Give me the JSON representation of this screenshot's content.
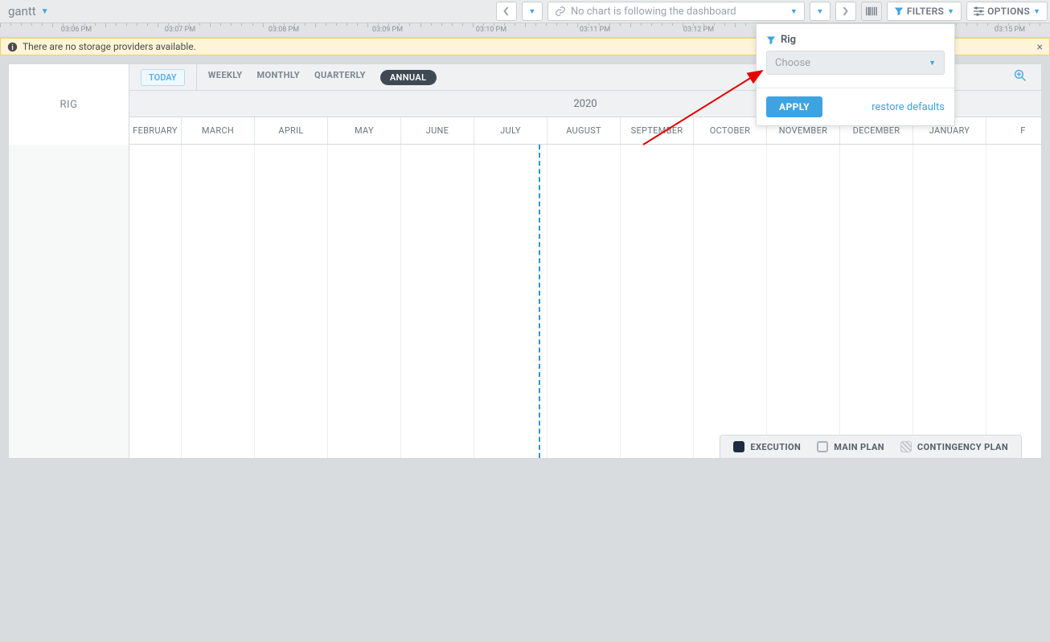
{
  "header": {
    "title": "gantt",
    "follow_text": "No chart is following the dashboard",
    "filters_label": "FILTERS",
    "options_label": "OPTIONS"
  },
  "ruler": {
    "labels": [
      "03:06 PM",
      "03:07 PM",
      "03:08 PM",
      "03:09 PM",
      "03:10 PM",
      "03:11 PM",
      "03:12 PM",
      "",
      "",
      "03:15 PM"
    ]
  },
  "warning": {
    "text": "There are no storage providers available."
  },
  "gantt": {
    "row_header": "RIG",
    "today_label": "TODAY",
    "views": {
      "weekly": "WEEKLY",
      "monthly": "MONTHLY",
      "quarterly": "QUARTERLY",
      "annual": "ANNUAL"
    },
    "year": "2020",
    "months": [
      "FEBRUARY",
      "MARCH",
      "APRIL",
      "MAY",
      "JUNE",
      "JULY",
      "AUGUST",
      "SEPTEMBER",
      "OCTOBER",
      "NOVEMBER",
      "DECEMBER",
      "JANUARY",
      "F"
    ]
  },
  "legend": {
    "execution": "EXECUTION",
    "main": "MAIN PLAN",
    "contingency": "CONTINGENCY PLAN"
  },
  "popover": {
    "title": "Rig",
    "choose_placeholder": "Choose",
    "apply": "APPLY",
    "restore": "restore defaults"
  }
}
